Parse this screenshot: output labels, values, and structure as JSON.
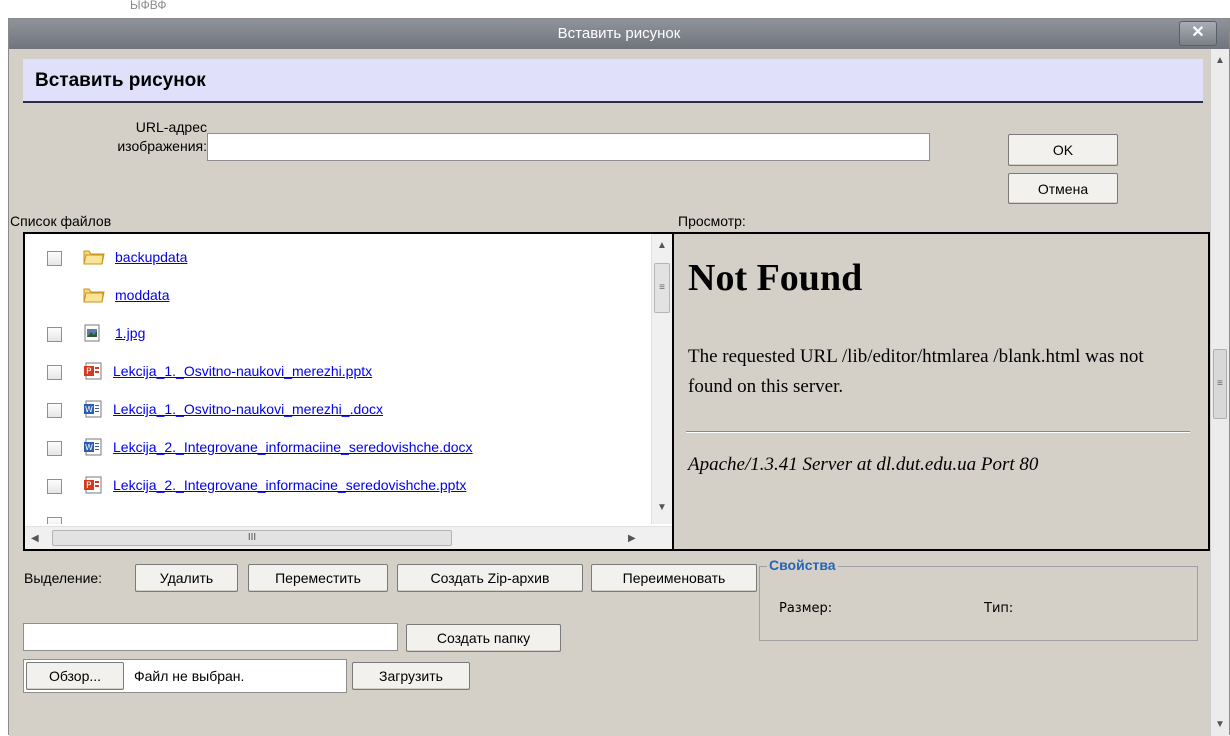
{
  "background": {
    "text": "ЫФВФ"
  },
  "window": {
    "title": "Вставить рисунок",
    "close_symbol": "✕"
  },
  "header": {
    "title": "Вставить рисунок"
  },
  "url": {
    "label_line1": "URL-адрес",
    "label_line2": "изображения:",
    "value": ""
  },
  "buttons": {
    "ok": "OK",
    "cancel": "Отмена"
  },
  "file_list": {
    "label": "Список файлов",
    "items": [
      {
        "name": "backupdata",
        "icon": "folder-icon",
        "checkbox": true
      },
      {
        "name": "moddata",
        "icon": "folder-icon",
        "checkbox": false
      },
      {
        "name": "1.jpg",
        "icon": "image-file-icon",
        "checkbox": true
      },
      {
        "name": "Lekcija_1._Osvitno-naukovi_merezhi.pptx",
        "icon": "powerpoint-file-icon",
        "checkbox": true
      },
      {
        "name": "Lekcija_1._Osvitno-naukovi_merezhi_.docx",
        "icon": "word-file-icon",
        "checkbox": true
      },
      {
        "name": "Lekcija_2._Integrovane_informaciine_seredovishche.docx",
        "icon": "word-file-icon",
        "checkbox": true
      },
      {
        "name": "Lekcija_2._Integrovane_informacine_seredovishche.pptx",
        "icon": "powerpoint-file-icon",
        "checkbox": true
      }
    ]
  },
  "preview": {
    "label": "Просмотр:",
    "title": "Not Found",
    "text": "The requested URL /lib/editor/htmlarea /blank.html was not found on this server.",
    "signature": "Apache/1.3.41 Server at dl.dut.edu.ua Port 80"
  },
  "selection": {
    "label": "Выделение:",
    "delete": "Удалить",
    "move": "Переместить",
    "zip": "Создать Zip-архив",
    "rename": "Переименовать"
  },
  "folder": {
    "value": "",
    "create_button": "Создать папку"
  },
  "upload": {
    "browse_button": "Обзор...",
    "file_status": "Файл не выбран.",
    "upload_button": "Загрузить"
  },
  "properties": {
    "legend": "Свойства",
    "size_label": "Размер:",
    "type_label": "Тип:"
  },
  "scrollbar": {
    "horizontal_grip": "III",
    "vertical_grip": "≡"
  }
}
